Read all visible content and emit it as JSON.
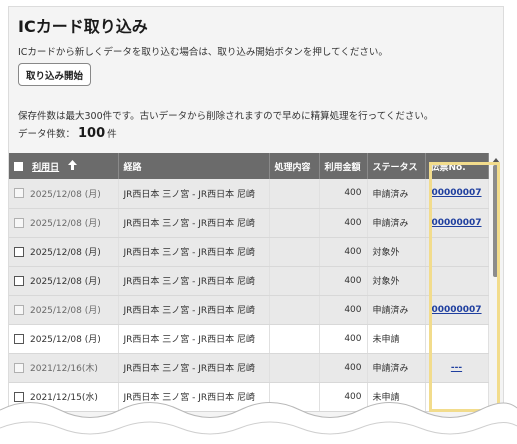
{
  "page": {
    "title": "ICカード取り込み",
    "description": "ICカードから新しくデータを取り込む場合は、取り込み開始ボタンを押してください。",
    "import_button": "取り込み開始",
    "note": "保存件数は最大300件です。古いデータから削除されますので早めに精算処理を行ってください。",
    "count_label": "データ件数：",
    "count_value": "100",
    "count_unit": "件"
  },
  "table": {
    "headers": {
      "date": "利用日",
      "route": "経路",
      "processing": "処理内容",
      "amount": "利用金額",
      "status": "ステータス",
      "slip": "伝票No."
    },
    "rows": [
      {
        "date": "2025/12/08 (月)",
        "route": "JR西日本 三ノ宮 - JR西日本 尼崎",
        "processing": "",
        "amount": "400",
        "status": "申請済み",
        "slip": "00000007"
      },
      {
        "date": "2025/12/08 (月)",
        "route": "JR西日本 三ノ宮 - JR西日本 尼崎",
        "processing": "",
        "amount": "400",
        "status": "申請済み",
        "slip": "00000007"
      },
      {
        "date": "2025/12/08 (月)",
        "route": "JR西日本 三ノ宮 - JR西日本 尼崎",
        "processing": "",
        "amount": "400",
        "status": "対象外",
        "slip": ""
      },
      {
        "date": "2025/12/08 (月)",
        "route": "JR西日本 三ノ宮 - JR西日本 尼崎",
        "processing": "",
        "amount": "400",
        "status": "対象外",
        "slip": ""
      },
      {
        "date": "2025/12/08 (月)",
        "route": "JR西日本 三ノ宮 - JR西日本 尼崎",
        "processing": "",
        "amount": "400",
        "status": "申請済み",
        "slip": "00000007"
      },
      {
        "date": "2025/12/08 (月)",
        "route": "JR西日本 三ノ宮 - JR西日本 尼崎",
        "processing": "",
        "amount": "400",
        "status": "未申請",
        "slip": ""
      },
      {
        "date": "2021/12/16(木)",
        "route": "JR西日本 三ノ宮 - JR西日本 尼崎",
        "processing": "",
        "amount": "400",
        "status": "申請済み",
        "slip": "---"
      },
      {
        "date": "2021/12/15(水)",
        "route": "JR西日本 三ノ宮 - JR西日本 尼崎",
        "processing": "",
        "amount": "400",
        "status": "未申請",
        "slip": ""
      }
    ]
  },
  "colors": {
    "header_bg": "#6b6b6b",
    "disabled_row_bg": "#e9e9e9",
    "link": "#1f3f9f",
    "status_applied": "#2d5fa8",
    "highlight": "#f2dc8c"
  },
  "icons": {
    "sort": "arrow-up-icon",
    "checkbox": "checkbox-icon",
    "scroll": "scroll-up-arrow-icon"
  }
}
